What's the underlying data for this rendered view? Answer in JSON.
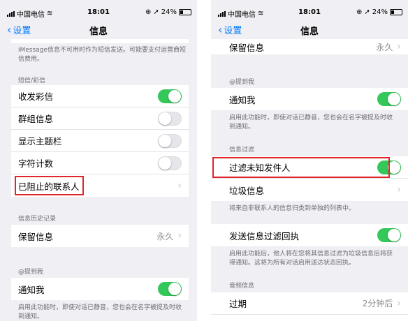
{
  "left": {
    "status": {
      "carrier": "中国电信",
      "time": "18:01",
      "battery": "24%"
    },
    "nav": {
      "back_label": "设置",
      "title": "信息"
    },
    "imessage_note": "iMessage信息不可用时作为短信发送。可能要支付运营商短信费用。",
    "sms_header": "短信/彩信",
    "rows": {
      "mms": "收发彩信",
      "group": "群组信息",
      "subject": "显示主题栏",
      "char_count": "字符计数",
      "blocked": "已阻止的联系人"
    },
    "history_header": "信息历史记录",
    "keep": {
      "label": "保留信息",
      "value": "永久"
    },
    "mention_header": "@提到我",
    "notify": {
      "label": "通知我"
    },
    "notify_note": "启用此功能时，即使对话已静音，您也会在名字被提及时收到通知。"
  },
  "right": {
    "status": {
      "carrier": "中国电信",
      "time": "18:01",
      "battery": "24%"
    },
    "nav": {
      "back_label": "设置",
      "title": "信息"
    },
    "keep": {
      "label": "保留信息",
      "value": "永久"
    },
    "mention_header": "@提到我",
    "notify": {
      "label": "通知我"
    },
    "notify_note": "启用此功能时，即使对话已静音，您也会在名字被提及时收到通知。",
    "filter_header": "信息过滤",
    "filter_unknown": {
      "label": "过滤未知发件人"
    },
    "junk": {
      "label": "垃圾信息"
    },
    "junk_note": "将来自非联系人的信息归类到单独的列表中。",
    "send_receipts": {
      "label": "发送信息过滤回执"
    },
    "receipts_note": "启用此功能后，他人将在您将其信息过滤为垃圾信息后将获得通知。这将为所有对话启用送达状态回执。",
    "audio_header": "音频信息",
    "expire": {
      "label": "过期",
      "value": "2分钟后"
    }
  },
  "toggles": {
    "left_mms": true,
    "left_group": false,
    "left_subject": false,
    "left_char": false,
    "left_notify": true,
    "right_notify": true,
    "right_filter": true,
    "right_receipts": true
  },
  "colors": {
    "accent": "#007aff",
    "toggle_on": "#34c759",
    "highlight": "#e0262b"
  },
  "icons": [
    "signal-icon",
    "wifi-icon",
    "lock-rotation-icon",
    "location-icon",
    "battery-icon",
    "chevron-left-icon",
    "chevron-right-icon"
  ]
}
